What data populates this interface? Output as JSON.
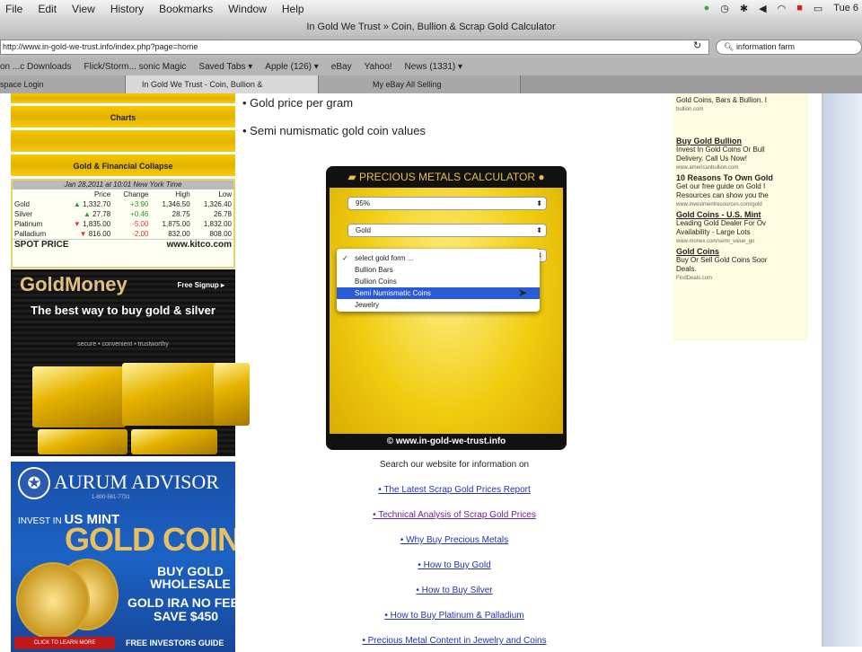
{
  "menubar": {
    "items": [
      "File",
      "Edit",
      "View",
      "History",
      "Bookmarks",
      "Window",
      "Help"
    ],
    "clock": "Tue 6"
  },
  "window": {
    "title": "In Gold We Trust » Coin, Bullion & Scrap Gold Calculator"
  },
  "urlbar": {
    "url": "http://www.in-gold-we-trust.info/index.php?page=home",
    "search": "information farm"
  },
  "bookmarks": [
    "on ...c Downloads",
    "Flick/Storm... sonic Magic",
    "Saved Tabs ▾",
    "Apple (126) ▾",
    "eBay",
    "Yahoo!",
    "News (1331) ▾"
  ],
  "tabs": [
    {
      "label": "space Login"
    },
    {
      "label": "In Gold We Trust - Coin, Bullion &"
    },
    {
      "label": "My eBay All Selling"
    }
  ],
  "left": {
    "nav": [
      "Charts",
      "",
      "Gold & Financial Collapse"
    ],
    "kitco": {
      "header": "Jan 28,2011 at 10:01 New York Time",
      "columns": [
        "",
        "Price",
        "Change",
        "High",
        "Low"
      ],
      "rows": [
        {
          "metal": "Gold",
          "price": "1,332.70",
          "change": "+3.90",
          "high": "1,346.50",
          "low": "1,326.40",
          "dir": "up"
        },
        {
          "metal": "Silver",
          "price": "27.78",
          "change": "+0.46",
          "high": "28.75",
          "low": "26.78",
          "dir": "up"
        },
        {
          "metal": "Platinum",
          "price": "1,835.00",
          "change": "-5.00",
          "high": "1,875.00",
          "low": "1,832.00",
          "dir": "down"
        },
        {
          "metal": "Palladium",
          "price": "816.00",
          "change": "-2.00",
          "high": "832.00",
          "low": "808.00",
          "dir": "down"
        }
      ],
      "footer_left": "SPOT PRICE",
      "footer_right": "www.kitco.com"
    },
    "goldmoney": {
      "logo": "GoldMoney",
      "signup": "Free Signup ▸",
      "tagline": "The best way to buy gold & silver",
      "sub": "secure • convenient • trustworthy"
    },
    "aurum": {
      "title": "AURUM ADVISOR",
      "phone": "1-800-561-7731",
      "invest": "INVEST IN",
      "mint": "US MINT",
      "coins": "GOLD COINS",
      "buy": "BUY GOLD WHOLESALE",
      "ira": "GOLD IRA NO FEES",
      "save": "SAVE $450",
      "button": "CLICK TO LEARN MORE",
      "free": "FREE INVESTORS GUIDE"
    }
  },
  "main": {
    "bullets": [
      "• Gold price per gram",
      "• Semi numismatic gold coin values"
    ],
    "calculator": {
      "title": "PRECIOUS METALS CALCULATOR",
      "select1": "95%",
      "select2": "Gold",
      "options": [
        "select gold form ...",
        "Bullion Bars",
        "Bullion Coins",
        "Semi Numismatic Coins",
        "Jewelry"
      ],
      "highlighted": 3,
      "checked": 0,
      "footer": "© www.in-gold-we-trust.info"
    },
    "search_text": "Search our website for information on",
    "links": [
      "• The Latest Scrap Gold Prices Report",
      "• Technical Analysis of Scrap Gold Prices",
      "• Why Buy Precious Metals",
      "• How to Buy Gold",
      "• How to Buy Silver",
      "• How to Buy Platinum & Palladium",
      "• Precious Metal Content in Jewelry and Coins"
    ]
  },
  "rightad": {
    "top": "Gold Coins, Bars & Bullion. I",
    "top_url": "bullion.com",
    "ads": [
      {
        "title": "Buy Gold Bullion",
        "l1": "Invest In Gold Coins Or Bull",
        "l2": "Delivery. Call Us Now!",
        "url": "www.americanbullion.com"
      },
      {
        "title": "10 Reasons To Own Gold",
        "l1": "Get our free guide on Gold I",
        "l2": "Resources can show you the",
        "url": "www.investmentresources.com/gold"
      },
      {
        "title": "Gold Coins - U.S. Mint",
        "l1": "Leading Gold Dealer For Ov",
        "l2": "Availability - Large Lots",
        "url": "www.monex.com/semi_value_go"
      },
      {
        "title": "Gold Coins",
        "l1": "Buy Or Sell Gold Coins Soor",
        "l2": "Deals.",
        "url": "FindDeals.com"
      }
    ]
  }
}
